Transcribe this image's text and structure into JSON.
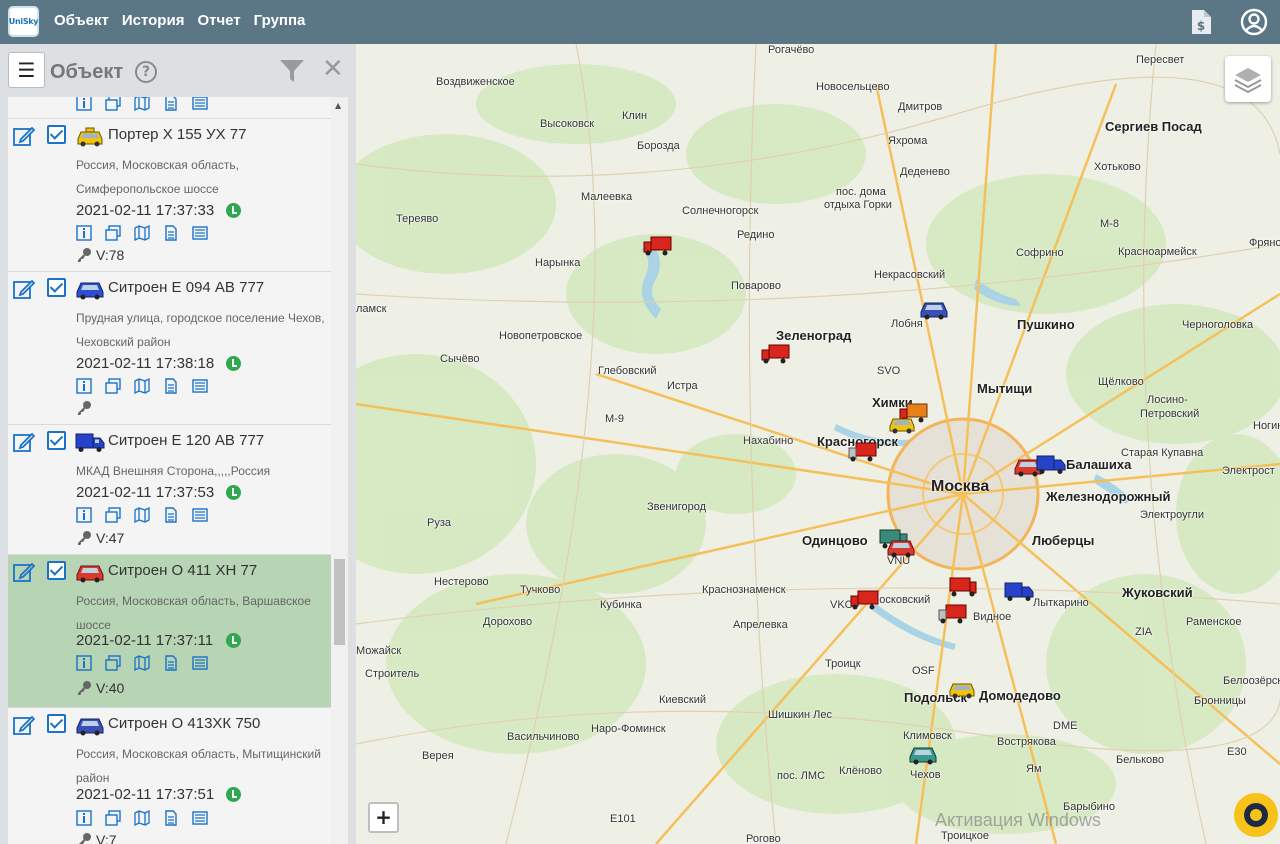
{
  "app": {
    "logo_text": "UniSky",
    "nav": [
      "Объект",
      "История",
      "Отчет",
      "Группа"
    ]
  },
  "panel": {
    "title": "Объект",
    "help_symbol": "?"
  },
  "icons": {
    "menu": "hamburger-icon",
    "filter": "filter-icon",
    "close": "close-icon",
    "doc": "invoice-document-icon",
    "user": "user-account-icon",
    "layers": "layers-icon"
  },
  "objects": [
    {
      "name": "Портер Х 155 УХ 77",
      "vehicle": "taxi",
      "address": "Россия, Московская область, Симферопольское шоссе",
      "time": "2021-02-11 17:37:33",
      "speed": "V:78",
      "selected": false
    },
    {
      "name": "Ситроен Е 094 АВ 777",
      "vehicle": "car-blue",
      "address": "Прудная улица, городское поселение Чехов, Чеховский район",
      "time": "2021-02-11 17:38:18",
      "speed": "",
      "selected": false
    },
    {
      "name": "Ситроен Е 120 АВ 777",
      "vehicle": "truck-blue",
      "address": "МКАД Внешняя Сторона,,,,,Россия",
      "time": "2021-02-11 17:37:53",
      "speed": "V:47",
      "selected": false
    },
    {
      "name": "Ситроен О 411 ХН 77",
      "vehicle": "car-red",
      "address": "Россия, Московская область, Варшавское шоссе",
      "time": "2021-02-11 17:37:11",
      "speed": "V:40",
      "selected": true
    },
    {
      "name": "Ситроен О 413ХК 750",
      "vehicle": "car-blue",
      "address": "Россия, Московская область, Мытищинский район",
      "time": "2021-02-11 17:37:51",
      "speed": "V:7",
      "selected": false
    }
  ],
  "map": {
    "zoom_in": "+",
    "watermark": "Активация Windows",
    "places": [
      {
        "name": "Рогачёво",
        "cls": ""
      },
      {
        "name": "Пересвет",
        "cls": ""
      },
      {
        "name": "Воздвиженское",
        "cls": ""
      },
      {
        "name": "Новосельцево",
        "cls": ""
      },
      {
        "name": "Клин",
        "cls": ""
      },
      {
        "name": "Высоковск",
        "cls": ""
      },
      {
        "name": "Дмитров",
        "cls": ""
      },
      {
        "name": "Сергиев Посад",
        "cls": "big"
      },
      {
        "name": "Борозда",
        "cls": ""
      },
      {
        "name": "Яхрома",
        "cls": ""
      },
      {
        "name": "Хотьково",
        "cls": ""
      },
      {
        "name": "Деденево",
        "cls": ""
      },
      {
        "name": "пос. дома",
        "cls": ""
      },
      {
        "name": "отдыха Горки",
        "cls": ""
      },
      {
        "name": "Малеевка",
        "cls": ""
      },
      {
        "name": "Солнечногорск",
        "cls": ""
      },
      {
        "name": "Тереяво",
        "cls": ""
      },
      {
        "name": "Редино",
        "cls": ""
      },
      {
        "name": "М-8",
        "cls": ""
      },
      {
        "name": "Фряно",
        "cls": ""
      },
      {
        "name": "Софрино",
        "cls": ""
      },
      {
        "name": "Красноармейск",
        "cls": ""
      },
      {
        "name": "Нарынка",
        "cls": ""
      },
      {
        "name": "Некрасовский",
        "cls": ""
      },
      {
        "name": "Поварово",
        "cls": ""
      },
      {
        "name": "Лобня",
        "cls": ""
      },
      {
        "name": "Пушкино",
        "cls": "big"
      },
      {
        "name": "Черноголовка",
        "cls": ""
      },
      {
        "name": "ламск",
        "cls": ""
      },
      {
        "name": "Новопетровское",
        "cls": ""
      },
      {
        "name": "Зеленоград",
        "cls": "big"
      },
      {
        "name": "Сычёво",
        "cls": ""
      },
      {
        "name": "Глебовский",
        "cls": ""
      },
      {
        "name": "SVO",
        "cls": ""
      },
      {
        "name": "Мытищи",
        "cls": "big"
      },
      {
        "name": "Щёлково",
        "cls": ""
      },
      {
        "name": "Истра",
        "cls": ""
      },
      {
        "name": "Химки",
        "cls": "big"
      },
      {
        "name": "Лосино-",
        "cls": ""
      },
      {
        "name": "Петровский",
        "cls": ""
      },
      {
        "name": "М-9",
        "cls": ""
      },
      {
        "name": "Ногинс",
        "cls": ""
      },
      {
        "name": "Нахабино",
        "cls": ""
      },
      {
        "name": "Красногорск",
        "cls": "big"
      },
      {
        "name": "Старая Купавна",
        "cls": ""
      },
      {
        "name": "Балашиха",
        "cls": "big"
      },
      {
        "name": "Электрост",
        "cls": ""
      },
      {
        "name": "Москва",
        "cls": "huge"
      },
      {
        "name": "Железнодорожный",
        "cls": "big"
      },
      {
        "name": "Звенигород",
        "cls": ""
      },
      {
        "name": "Электроугли",
        "cls": ""
      },
      {
        "name": "Руза",
        "cls": ""
      },
      {
        "name": "Одинцово",
        "cls": "big"
      },
      {
        "name": "Люберцы",
        "cls": "big"
      },
      {
        "name": "VNU",
        "cls": ""
      },
      {
        "name": "Нестерово",
        "cls": ""
      },
      {
        "name": "Тучково",
        "cls": ""
      },
      {
        "name": "Краснознаменск",
        "cls": ""
      },
      {
        "name": "Жуковский",
        "cls": "big"
      },
      {
        "name": "VKO",
        "cls": ""
      },
      {
        "name": "Московский",
        "cls": ""
      },
      {
        "name": "Лыткарино",
        "cls": ""
      },
      {
        "name": "Кубинка",
        "cls": ""
      },
      {
        "name": "Видное",
        "cls": ""
      },
      {
        "name": "Дорохово",
        "cls": ""
      },
      {
        "name": "Апрелевка",
        "cls": ""
      },
      {
        "name": "ZIA",
        "cls": ""
      },
      {
        "name": "Раменское",
        "cls": ""
      },
      {
        "name": "Можайск",
        "cls": ""
      },
      {
        "name": "Троицк",
        "cls": ""
      },
      {
        "name": "OSF",
        "cls": ""
      },
      {
        "name": "Строитель",
        "cls": ""
      },
      {
        "name": "Белоозёрский",
        "cls": ""
      },
      {
        "name": "Подольск",
        "cls": "big"
      },
      {
        "name": "Домодедово",
        "cls": "big"
      },
      {
        "name": "Киевский",
        "cls": ""
      },
      {
        "name": "Бронницы",
        "cls": ""
      },
      {
        "name": "Шишкин Лес",
        "cls": ""
      },
      {
        "name": "DME",
        "cls": ""
      },
      {
        "name": "Васильчиново",
        "cls": ""
      },
      {
        "name": "Наро-Фоминск",
        "cls": ""
      },
      {
        "name": "Климовск",
        "cls": ""
      },
      {
        "name": "Вострякова",
        "cls": ""
      },
      {
        "name": "Верея",
        "cls": ""
      },
      {
        "name": "Е30",
        "cls": ""
      },
      {
        "name": "Клёново",
        "cls": ""
      },
      {
        "name": "пос. ЛМС",
        "cls": ""
      },
      {
        "name": "Чехов",
        "cls": ""
      },
      {
        "name": "Ям",
        "cls": ""
      },
      {
        "name": "Бельково",
        "cls": ""
      },
      {
        "name": "Барыбино",
        "cls": ""
      },
      {
        "name": "Е101",
        "cls": ""
      },
      {
        "name": "Рогово",
        "cls": ""
      },
      {
        "name": "Троицкое",
        "cls": ""
      }
    ]
  }
}
